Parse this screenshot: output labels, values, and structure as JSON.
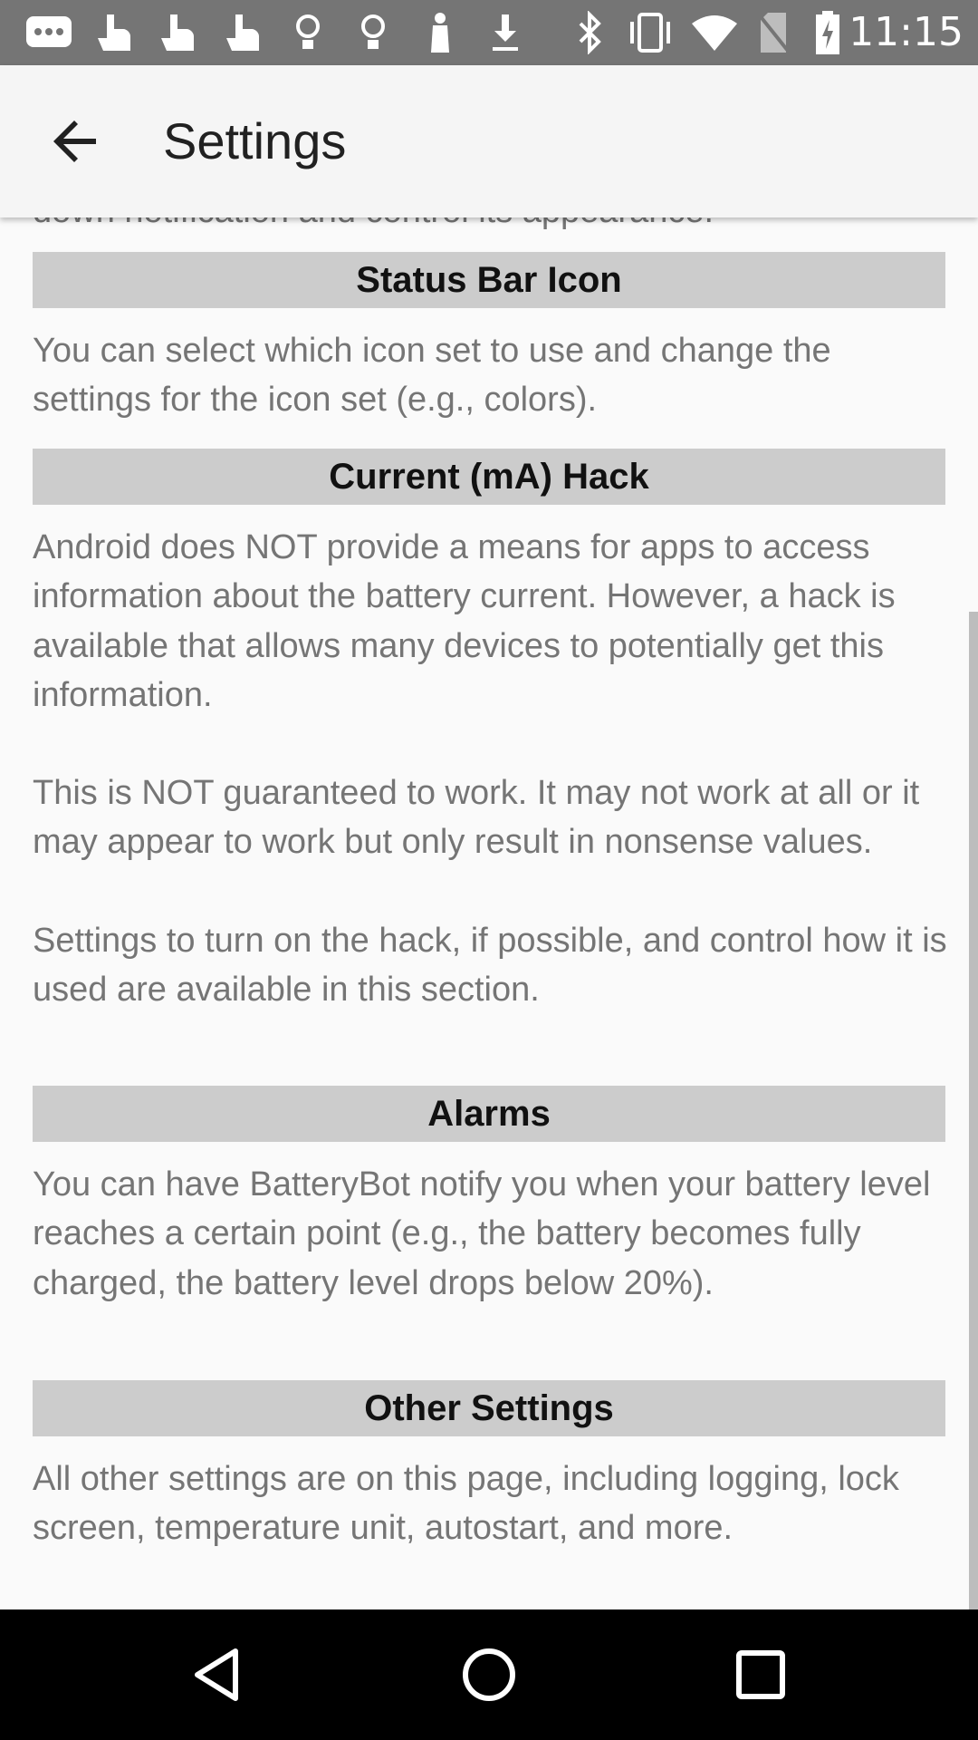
{
  "status_bar": {
    "time": "11:15",
    "left_icons": [
      "message-icon",
      "hand-icon",
      "hand-icon",
      "hand-icon",
      "lightbulb-icon",
      "lightbulb-icon",
      "figure-icon",
      "download-icon"
    ],
    "right_icons": [
      "bluetooth-icon",
      "vibrate-icon",
      "wifi-icon",
      "no-sim-icon",
      "battery-charging-icon"
    ]
  },
  "app_bar": {
    "title": "Settings"
  },
  "content": {
    "clipped_text": "down notification and control its appearance.",
    "sections": [
      {
        "header": "Status Bar Icon",
        "paragraphs": [
          "You can select which icon set to use and change the settings for the icon set (e.g., colors)."
        ]
      },
      {
        "header": "Current (mA) Hack",
        "paragraphs": [
          "Android does NOT provide a means for apps to access information about the battery current. However, a hack is available that allows many devices to potentially get this information.",
          "This is NOT guaranteed to work. It may not work at all or it may appear to work but only result in nonsense values.",
          "Settings to turn on the hack, if possible, and control how it is used are available in this section."
        ]
      },
      {
        "header": "Alarms",
        "paragraphs": [
          "You can have BatteryBot notify you when your battery level reaches a certain point (e.g., the battery becomes fully charged, the battery level drops below 20%)."
        ]
      },
      {
        "header": "Other Settings",
        "paragraphs": [
          "All other settings are on this page, including logging, lock screen, temperature unit, autostart, and more."
        ]
      }
    ]
  },
  "nav_bar": {
    "buttons": [
      "back",
      "home",
      "recents"
    ]
  }
}
